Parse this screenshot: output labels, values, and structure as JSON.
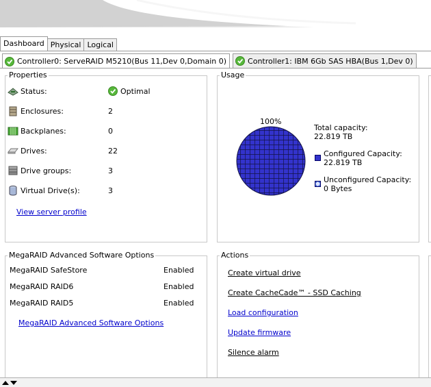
{
  "top_tabs": [
    "Dashboard",
    "Physical",
    "Logical"
  ],
  "controller_tabs": [
    {
      "label": "Controller0: ServeRAID M5210(Bus 11,Dev 0,Domain 0)"
    },
    {
      "label": "Controller1: IBM 6Gb SAS HBA(Bus 1,Dev 0)"
    }
  ],
  "properties": {
    "title": "Properties",
    "rows": [
      {
        "label": "Status:",
        "value": "Optimal",
        "icon": "status-icon"
      },
      {
        "label": "Enclosures:",
        "value": "2",
        "icon": "enclosure-icon"
      },
      {
        "label": "Backplanes:",
        "value": "0",
        "icon": "backplane-icon"
      },
      {
        "label": "Drives:",
        "value": "22",
        "icon": "drive-icon"
      },
      {
        "label": "Drive groups:",
        "value": "3",
        "icon": "drive-group-icon"
      },
      {
        "label": "Virtual Drive(s):",
        "value": "3",
        "icon": "virtual-drive-icon"
      }
    ],
    "link": "View server profile"
  },
  "usage": {
    "title": "Usage",
    "percent_label": "100%",
    "configured_fraction": 1.0,
    "total_label": "Total capacity:",
    "total_value": "22.819 TB",
    "configured_label": "Configured Capacity:",
    "configured_value": "22.819 TB",
    "unconfigured_label": "Unconfigured Capacity:",
    "unconfigured_value": "0 Bytes",
    "configured_color": "#3333cc",
    "unconfigured_color": "#5577dd"
  },
  "options": {
    "title": "MegaRAID Advanced Software Options",
    "rows": [
      {
        "name": "MegaRAID SafeStore",
        "status": "Enabled"
      },
      {
        "name": "MegaRAID RAID6",
        "status": "Enabled"
      },
      {
        "name": "MegaRAID RAID5",
        "status": "Enabled"
      }
    ],
    "link": "MegaRAID Advanced Software Options"
  },
  "actions": {
    "title": "Actions",
    "items": [
      "Create virtual drive",
      "Create CacheCade™ - SSD Caching",
      "Load configuration",
      "Update firmware",
      "Silence alarm"
    ]
  }
}
